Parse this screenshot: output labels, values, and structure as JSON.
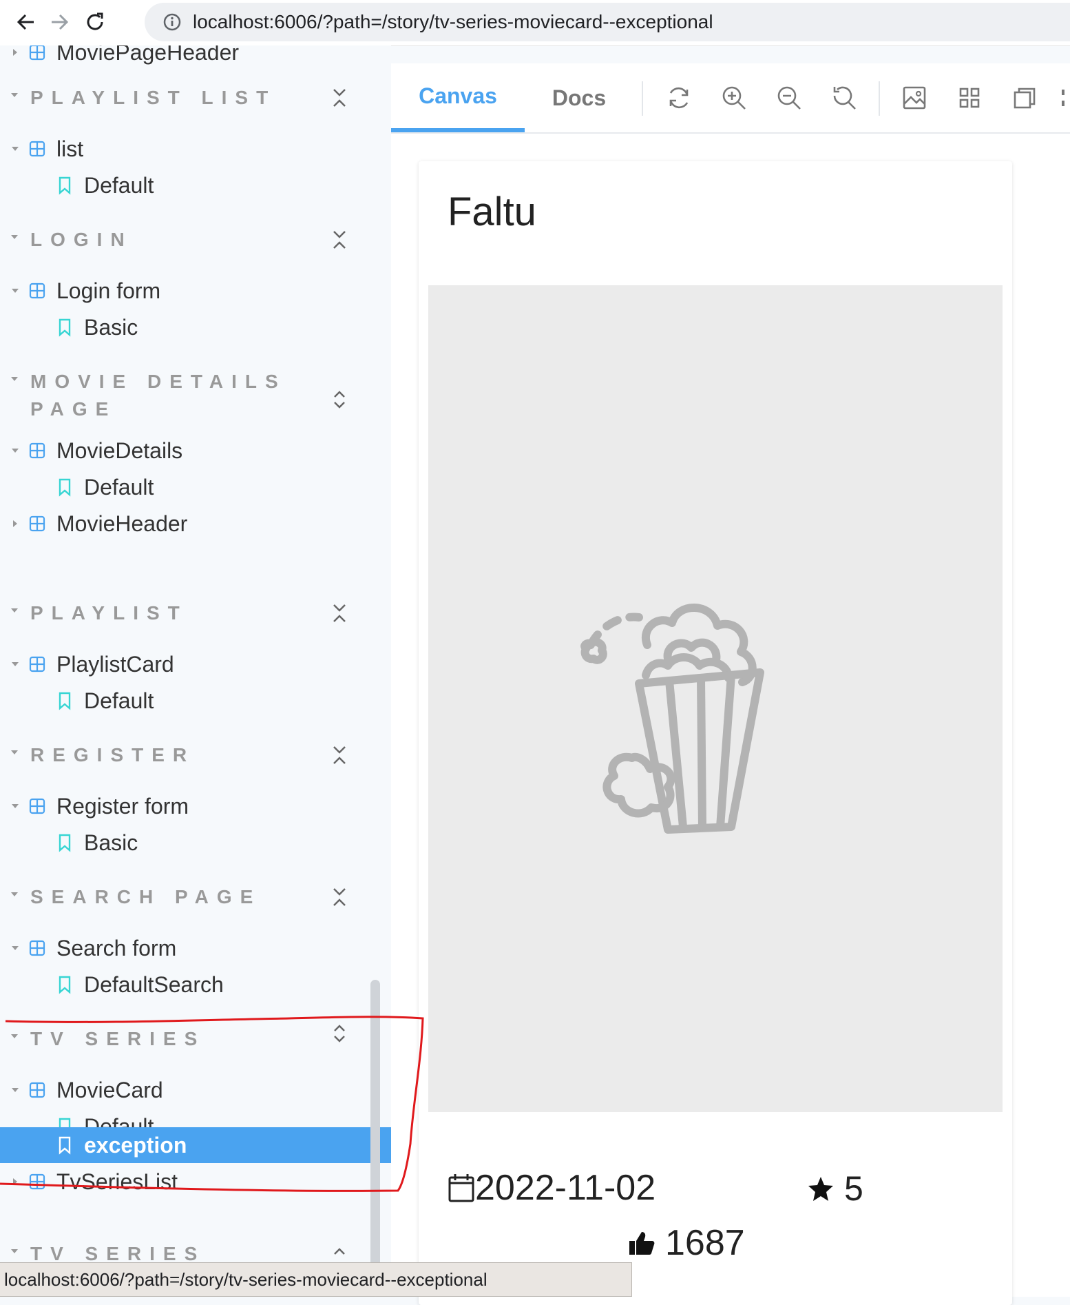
{
  "browser": {
    "url": "localhost:6006/?path=/story/tv-series-moviecard--exceptional",
    "status_url": "localhost:6006/?path=/story/tv-series-moviecard--exceptional"
  },
  "sidebar": {
    "top_item": "MoviePageHeader",
    "groups": [
      {
        "title": "PLAYLIST LIST",
        "components": [
          {
            "label": "list",
            "stories": [
              "Default"
            ]
          }
        ]
      },
      {
        "title": "LOGIN",
        "components": [
          {
            "label": "Login form",
            "stories": [
              "Basic"
            ]
          }
        ]
      },
      {
        "title": "MOVIE DETAILS PAGE",
        "components": [
          {
            "label": "MovieDetails",
            "stories": [
              "Default"
            ]
          },
          {
            "label": "MovieHeader",
            "stories": []
          }
        ]
      },
      {
        "title": "PLAYLIST",
        "components": [
          {
            "label": "PlaylistCard",
            "stories": [
              "Default"
            ]
          }
        ]
      },
      {
        "title": "REGISTER",
        "components": [
          {
            "label": "Register form",
            "stories": [
              "Basic"
            ]
          }
        ]
      },
      {
        "title": "SEARCH PAGE",
        "components": [
          {
            "label": "Search form",
            "stories": [
              "DefaultSearch"
            ]
          }
        ]
      },
      {
        "title": "TV SERIES",
        "components": [
          {
            "label": "MovieCard",
            "stories": [
              "Default",
              "exception"
            ]
          },
          {
            "label": "TvSeriesList",
            "stories": []
          }
        ]
      },
      {
        "title": "TV SERIES",
        "components": []
      }
    ],
    "selected_story": "exception"
  },
  "toolbar": {
    "tabs": [
      "Canvas",
      "Docs"
    ],
    "active_tab": "Canvas"
  },
  "card": {
    "title": "Faltu",
    "date": "2022-11-02",
    "rating": "5",
    "likes": "1687"
  },
  "colors": {
    "accent": "#4aa3f0",
    "annotation": "#e0191c",
    "poster_bg": "#ebebeb"
  }
}
